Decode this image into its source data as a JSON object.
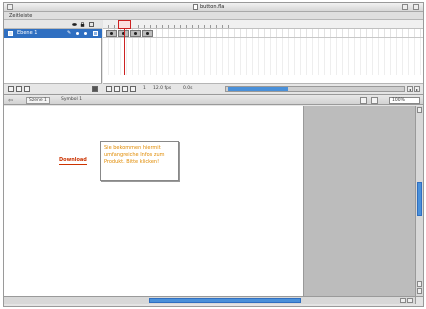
{
  "window": {
    "title": "button.fla"
  },
  "timeline": {
    "header_label": "Zeitleiste"
  },
  "layers": [
    {
      "name": "Ebene 1"
    }
  ],
  "frames_status": {
    "frame": "1",
    "rate": "12.0 fps",
    "time": "0.0s"
  },
  "edit_bar": {
    "scene_label": "Szene 1",
    "symbol_label": "Symbol 1",
    "zoom_value": "100%"
  },
  "stage": {
    "button_text": "Download",
    "tooltip_lines": [
      "Sie bekommen hiermit",
      "umfangreiche Infos zum",
      "Produkt. Bitte klicken!"
    ]
  },
  "colors": {
    "accent": "#4a90d9",
    "playhead": "#cc2222",
    "button_text": "#cc3300",
    "tooltip_text": "#e08a00"
  }
}
